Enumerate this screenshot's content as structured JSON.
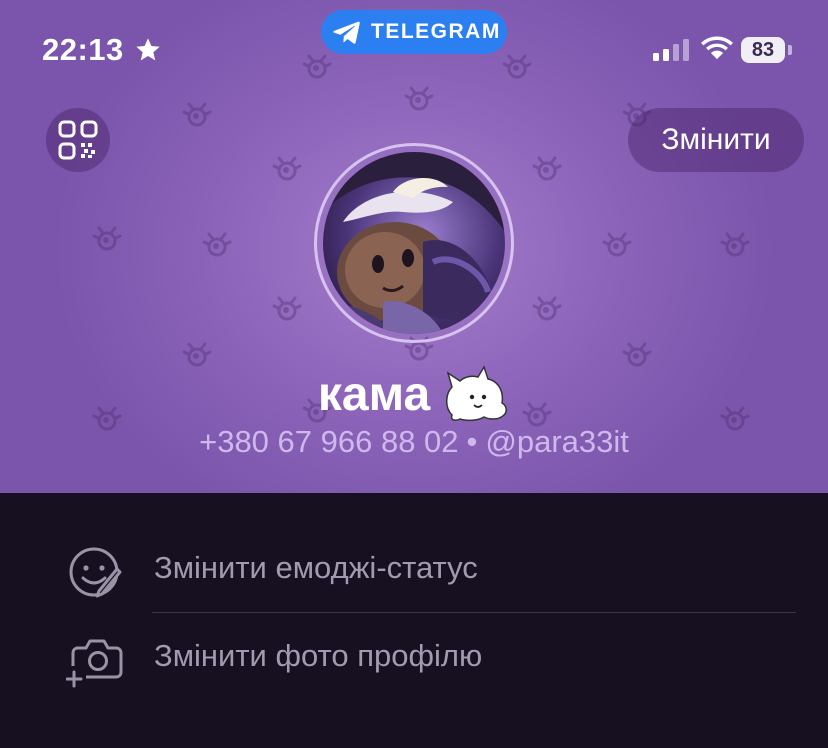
{
  "status_bar": {
    "time": "22:13",
    "app_badge": "TELEGRAM",
    "battery": "83"
  },
  "header": {
    "edit_label": "Змінити"
  },
  "profile": {
    "name": "кама",
    "phone": "+380 67 966 88 02",
    "separator": "•",
    "username": "@para33it"
  },
  "menu": {
    "items": [
      {
        "label": "Змінити емоджі-статус",
        "icon": "emoji-status-icon"
      },
      {
        "label": "Змінити фото профілю",
        "icon": "camera-add-icon"
      }
    ]
  },
  "colors": {
    "header_gradient_center": "#a77fcc",
    "header_gradient_edge": "#7a55ab",
    "background": "#161021",
    "telegram_blue": "#2b7ff1",
    "menu_text": "#a19ab0",
    "contact_text": "#cfb8ee"
  }
}
